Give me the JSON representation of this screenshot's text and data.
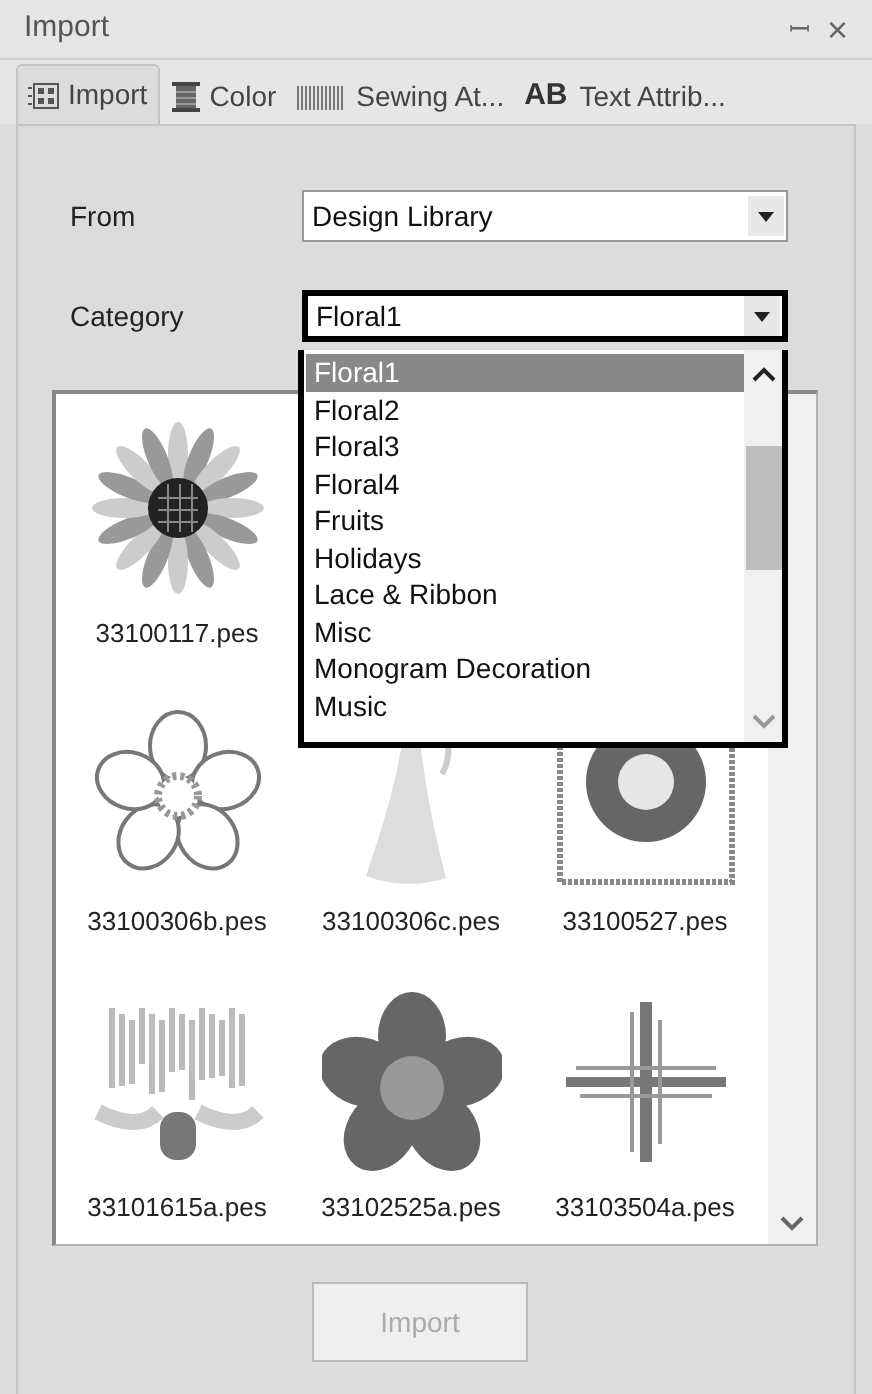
{
  "window": {
    "title": "Import",
    "pin": "ꟷ",
    "close": "×"
  },
  "tabs": [
    {
      "label": "Import",
      "kind": "grid",
      "selected": true
    },
    {
      "label": "Color",
      "kind": "spool",
      "selected": false
    },
    {
      "label": "Sewing At...",
      "kind": "stripes",
      "selected": false
    },
    {
      "label": "Text Attrib...",
      "kind": "letters",
      "icon_text": "AB",
      "selected": false
    }
  ],
  "from": {
    "label": "From",
    "value": "Design Library"
  },
  "category": {
    "label": "Category",
    "value": "Floral1",
    "expanded": true,
    "options": [
      {
        "label": "Floral1",
        "selected": true
      },
      {
        "label": "Floral2",
        "selected": false
      },
      {
        "label": "Floral3",
        "selected": false
      },
      {
        "label": "Floral4",
        "selected": false
      },
      {
        "label": "Fruits",
        "selected": false
      },
      {
        "label": "Holidays",
        "selected": false
      },
      {
        "label": "Lace & Ribbon",
        "selected": false
      },
      {
        "label": "Misc",
        "selected": false
      },
      {
        "label": "Monogram Decoration",
        "selected": false
      },
      {
        "label": "Music",
        "selected": false
      }
    ]
  },
  "designs": [
    [
      {
        "name": "33100117.pes",
        "kind": "sunflower"
      }
    ],
    [
      {
        "name": "33100306b.pes",
        "kind": "outline-flower"
      },
      {
        "name": "33100306c.pes",
        "kind": "bell"
      },
      {
        "name": "33100527.pes",
        "kind": "framed-wreath"
      }
    ],
    [
      {
        "name": "33101615a.pes",
        "kind": "tulip"
      },
      {
        "name": "33102525a.pes",
        "kind": "blossom"
      },
      {
        "name": "33103504a.pes",
        "kind": "cross"
      }
    ]
  ],
  "import_button": {
    "label": "Import",
    "disabled": true
  }
}
